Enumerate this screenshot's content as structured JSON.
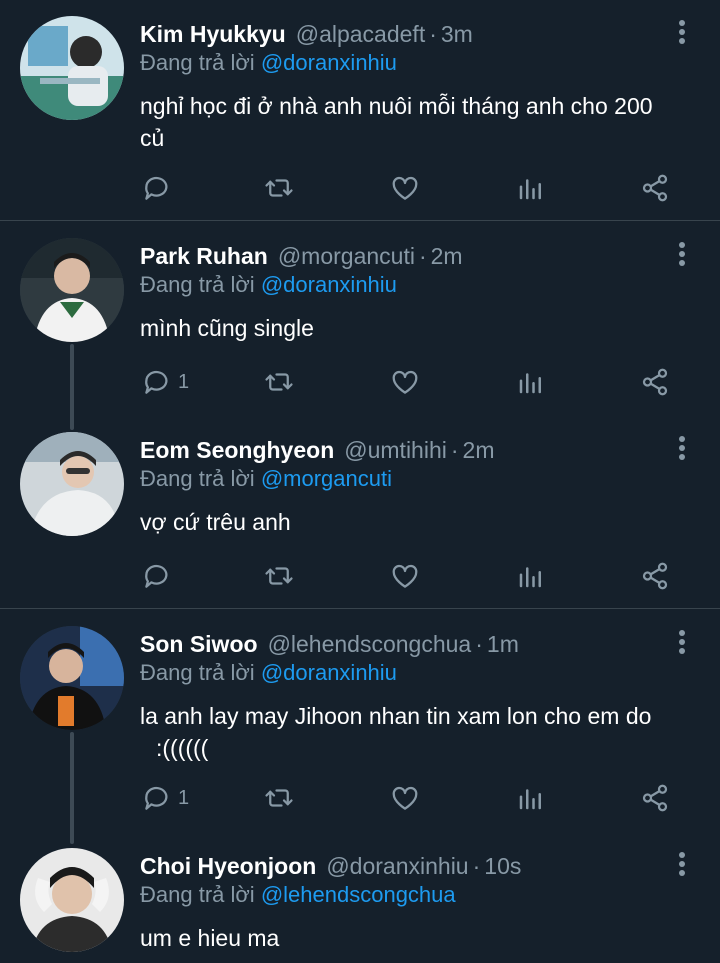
{
  "replying_prefix": "Đang trả lời",
  "tweets": [
    {
      "name": "Kim Hyukkyu",
      "handle": "@alpacadeft",
      "time": "3m",
      "replying_to": "@doranxinhiu",
      "text_line1": "nghỉ học đi ở nhà anh nuôi mỗi tháng anh cho 200",
      "text_line2": "củ",
      "reply_count": ""
    },
    {
      "name": "Park Ruhan",
      "handle": "@morgancuti",
      "time": "2m",
      "replying_to": "@doranxinhiu",
      "text_line1": "mình cũng single",
      "reply_count": "1"
    },
    {
      "name": "Eom Seonghyeon",
      "handle": "@umtihihi",
      "time": "2m",
      "replying_to": "@morgancuti",
      "text_line1": "vợ cứ trêu anh",
      "reply_count": ""
    },
    {
      "name": "Son Siwoo",
      "handle": "@lehendscongchua",
      "time": "1m",
      "replying_to": "@doranxinhiu",
      "text_line1": "la anh lay may Jihoon nhan tin xam lon cho em do",
      "text_line2": ":((((((",
      "reply_count": "1"
    },
    {
      "name": "Choi Hyeonjoon",
      "handle": "@doranxinhiu",
      "time": "10s",
      "replying_to": "@lehendscongchua",
      "text_line1": "um e hieu ma"
    }
  ],
  "icons": {
    "reply": "reply-icon",
    "retweet": "retweet-icon",
    "like": "heart-icon",
    "stats": "stats-icon",
    "share": "share-icon",
    "more": "more-vertical-icon"
  },
  "colors": {
    "background": "#15202b",
    "mention": "#1d9bf0",
    "muted": "#8899a6",
    "divider": "#38444d"
  }
}
